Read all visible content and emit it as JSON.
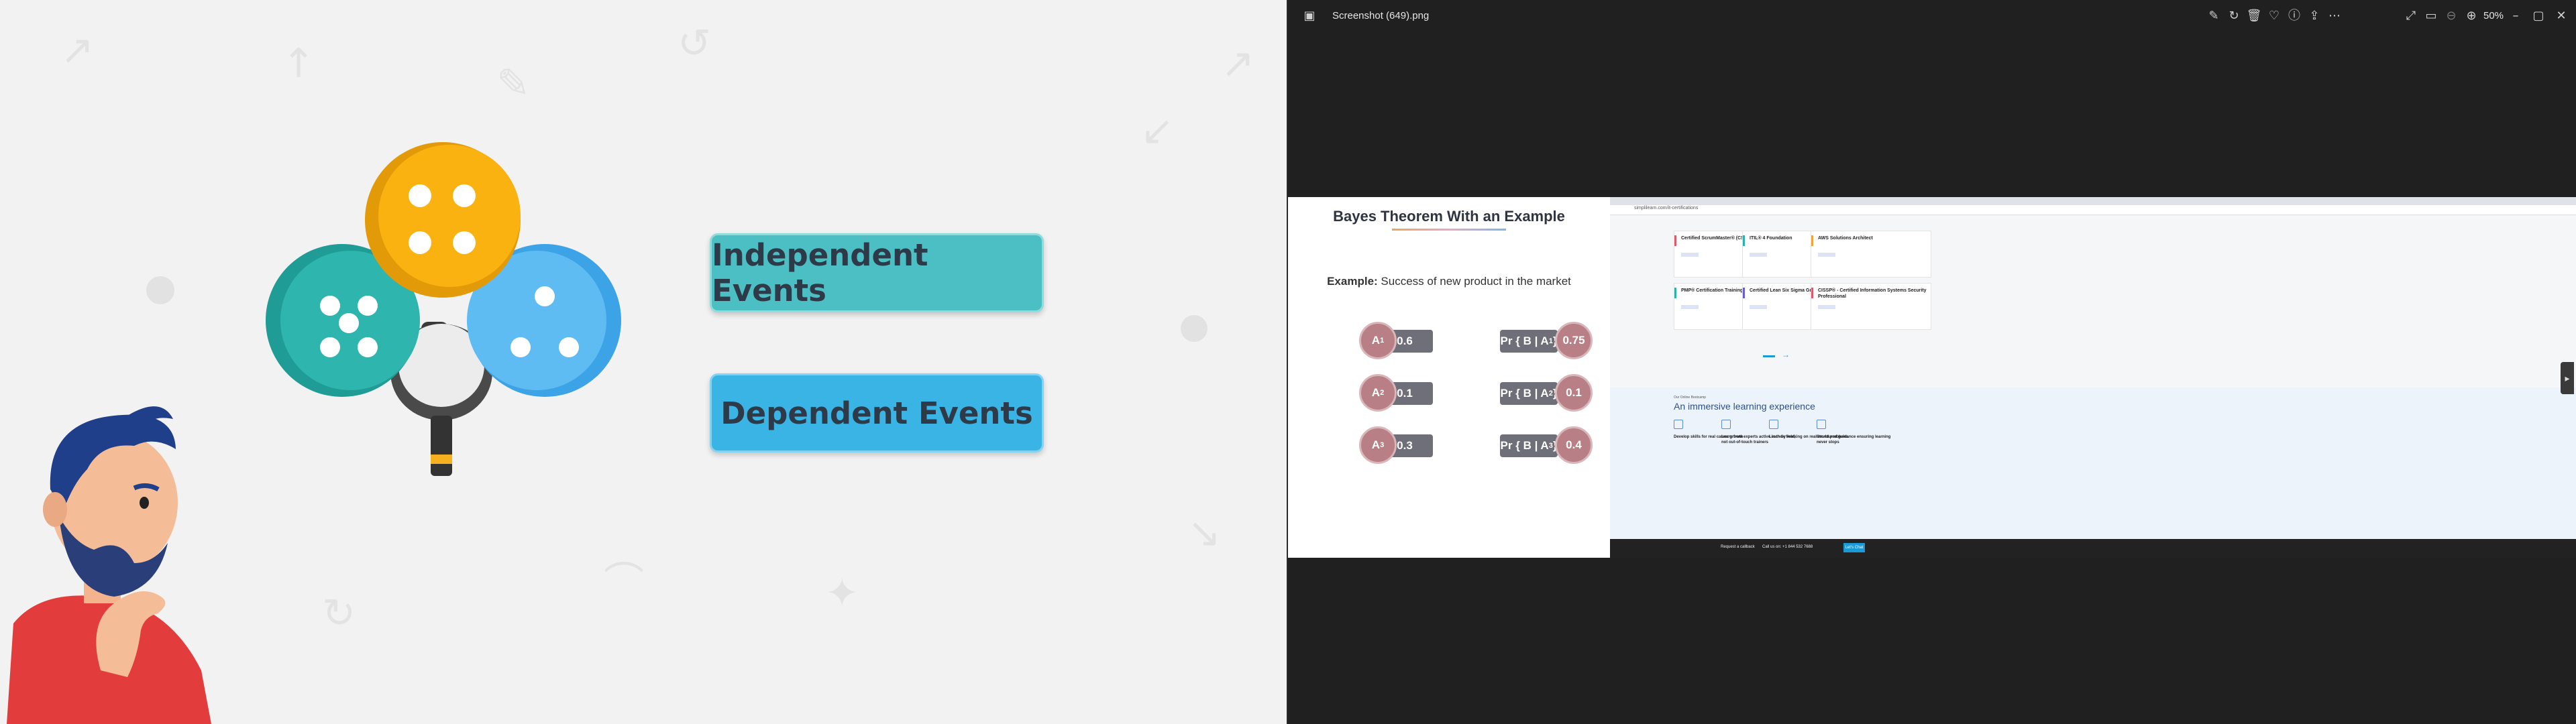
{
  "left_slide": {
    "buttons": {
      "independent": "Independent Events",
      "dependent": "Dependent Events"
    }
  },
  "viewer": {
    "title": "Screenshot (649).png",
    "zoom": "50%"
  },
  "bayes_slide": {
    "title": "Bayes Theorem With an Example",
    "example_label": "Example:",
    "example_text": "Success of new product in the market",
    "priors": [
      {
        "event": "A",
        "sub": "1",
        "value": "0.6"
      },
      {
        "event": "A",
        "sub": "2",
        "value": "0.1"
      },
      {
        "event": "A",
        "sub": "3",
        "value": "0.3"
      }
    ],
    "likelihoods": [
      {
        "label": "Pr { B | A",
        "sub": "1",
        "close": " }",
        "value": "0.75"
      },
      {
        "label": "Pr { B | A",
        "sub": "2",
        "close": " }",
        "value": "0.1"
      },
      {
        "label": "Pr { B | A",
        "sub": "3",
        "close": " }",
        "value": "0.4"
      }
    ]
  },
  "browser": {
    "url": "simplilearn.com/it-certifications",
    "courses": [
      {
        "title": "Certified ScrumMaster® (CSM)",
        "color": "#e05a6b"
      },
      {
        "title": "ITIL® 4 Foundation",
        "color": "#2bb3a8"
      },
      {
        "title": "AWS Solutions Architect",
        "color": "#f2a43a"
      },
      {
        "title": "PMP® Certification Training",
        "color": "#2bb3a8"
      },
      {
        "title": "Certified Lean Six Sigma Green Belt",
        "color": "#6b5bd6"
      },
      {
        "title": "CISSP® - Certified Information Systems Security Professional",
        "color": "#e05a6b"
      }
    ],
    "immersive": {
      "kicker": "Our Online Bootcamp",
      "title": "An immersive learning experience",
      "features": [
        "Develop skills for real career growth",
        "Learn from experts active in their field, not out-of-touch trainers",
        "Learn by working on real-world problems",
        "Structured guidance ensuring learning never stops"
      ]
    },
    "bottom_bar": {
      "callback": "Request a callback",
      "call": "Call us on: +1 844 532 7688",
      "enroll": "Let's Chat"
    }
  }
}
